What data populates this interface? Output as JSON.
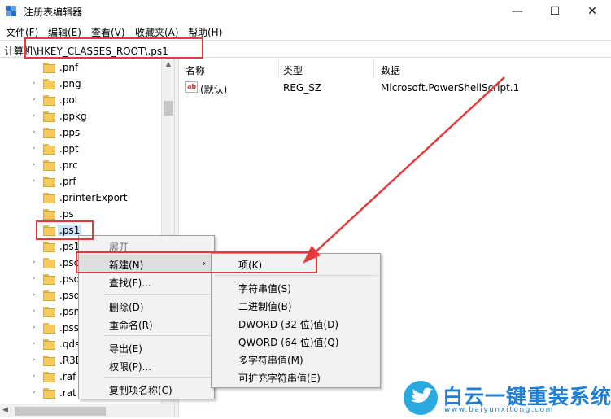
{
  "window": {
    "title": "注册表编辑器",
    "minimize_label": "—",
    "maximize_label": "☐",
    "close_label": "✕"
  },
  "menubar": [
    {
      "label": "文件(F)"
    },
    {
      "label": "编辑(E)"
    },
    {
      "label": "查看(V)"
    },
    {
      "label": "收藏夹(A)"
    },
    {
      "label": "帮助(H)"
    }
  ],
  "address": {
    "path": "计算机\\HKEY_CLASSES_ROOT\\.ps1"
  },
  "tree": {
    "items": [
      {
        "label": ".pnf",
        "expander": ""
      },
      {
        "label": ".png",
        "expander": "›"
      },
      {
        "label": ".pot",
        "expander": "›"
      },
      {
        "label": ".ppkg",
        "expander": "›"
      },
      {
        "label": ".pps",
        "expander": "›"
      },
      {
        "label": ".ppt",
        "expander": "›"
      },
      {
        "label": ".prc",
        "expander": "›"
      },
      {
        "label": ".prf",
        "expander": "›"
      },
      {
        "label": ".printerExport",
        "expander": ""
      },
      {
        "label": ".ps",
        "expander": ""
      },
      {
        "label": ".ps1",
        "expander": ""
      },
      {
        "label": ".ps1",
        "expander": ""
      },
      {
        "label": ".psc",
        "expander": "›"
      },
      {
        "label": ".psd",
        "expander": "›"
      },
      {
        "label": ".psd",
        "expander": "›"
      },
      {
        "label": ".psm",
        "expander": "›"
      },
      {
        "label": ".pss",
        "expander": "›"
      },
      {
        "label": ".qds",
        "expander": "›"
      },
      {
        "label": ".R3D",
        "expander": "›"
      },
      {
        "label": ".raf",
        "expander": "›"
      },
      {
        "label": ".rat",
        "expander": "›"
      }
    ]
  },
  "list": {
    "columns": [
      "名称",
      "类型",
      "数据"
    ],
    "rows": [
      {
        "name": "(默认)",
        "type": "REG_SZ",
        "data": "Microsoft.PowerShellScript.1",
        "icon_text": "ab"
      }
    ]
  },
  "context_menu": {
    "items": [
      {
        "label": "展开",
        "disabled": true
      },
      {
        "label": "新建(N)",
        "submenu": true,
        "arrow": "›"
      },
      {
        "label": "查找(F)..."
      },
      {
        "label": "删除(D)"
      },
      {
        "label": "重命名(R)"
      },
      {
        "label": "导出(E)"
      },
      {
        "label": "权限(P)..."
      },
      {
        "label": "复制项名称(C)"
      }
    ]
  },
  "submenu": {
    "items": [
      {
        "label": "项(K)"
      },
      {
        "label": "字符串值(S)"
      },
      {
        "label": "二进制值(B)"
      },
      {
        "label": "DWORD (32 位)值(D)"
      },
      {
        "label": "QWORD (64 位)值(Q)"
      },
      {
        "label": "多字符串值(M)"
      },
      {
        "label": "可扩充字符串值(E)"
      }
    ]
  },
  "watermark": {
    "title": "白云一键重装系统",
    "url": "www.baiyunxitong.com"
  },
  "colors": {
    "annotation_red": "#e53a3a",
    "selection_blue": "#cce4f7",
    "watermark_blue": "#1e7fd6"
  }
}
